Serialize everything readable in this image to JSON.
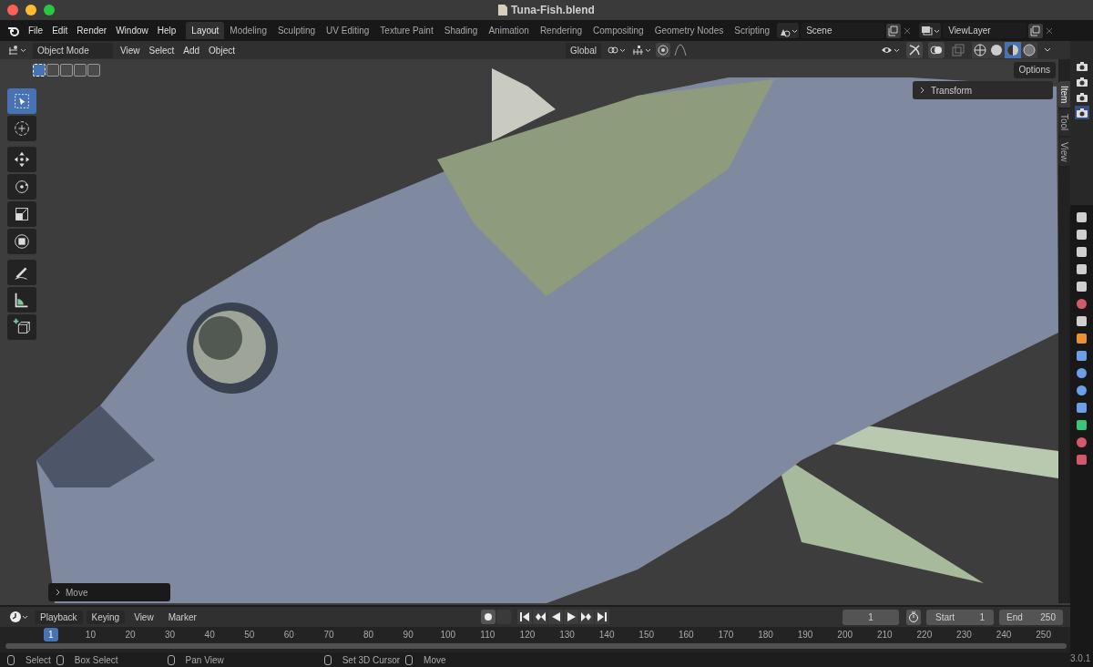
{
  "window": {
    "title": "Tuna-Fish.blend"
  },
  "menus": [
    "File",
    "Edit",
    "Render",
    "Window",
    "Help"
  ],
  "workspaces": [
    {
      "label": "Layout",
      "selected": true
    },
    {
      "label": "Modeling",
      "selected": false
    },
    {
      "label": "Sculpting",
      "selected": false
    },
    {
      "label": "UV Editing",
      "selected": false
    },
    {
      "label": "Texture Paint",
      "selected": false
    },
    {
      "label": "Shading",
      "selected": false
    },
    {
      "label": "Animation",
      "selected": false
    },
    {
      "label": "Rendering",
      "selected": false
    },
    {
      "label": "Compositing",
      "selected": false
    },
    {
      "label": "Geometry Nodes",
      "selected": false
    },
    {
      "label": "Scripting",
      "selected": false
    }
  ],
  "scene": "Scene",
  "view_layer": "ViewLayer",
  "viewport_header": {
    "mode": "Object Mode",
    "menus": [
      "View",
      "Select",
      "Add",
      "Object"
    ],
    "orientation": "Global",
    "select_modes": [
      {
        "selected": true
      },
      {
        "selected": false
      },
      {
        "selected": false
      },
      {
        "selected": false
      },
      {
        "selected": false
      }
    ],
    "shading": [
      {
        "kind": "wireframe",
        "selected": false
      },
      {
        "kind": "solid",
        "selected": false
      },
      {
        "kind": "material",
        "selected": true
      },
      {
        "kind": "rendered",
        "selected": false
      }
    ]
  },
  "tools": [
    {
      "kind": "select",
      "selected": true
    },
    {
      "kind": "cursor",
      "selected": false
    },
    {
      "kind": "move",
      "selected": false
    },
    {
      "kind": "rotate",
      "selected": false
    },
    {
      "kind": "scale",
      "selected": false
    },
    {
      "kind": "transform",
      "selected": false
    },
    {
      "kind": "annotate",
      "selected": false
    },
    {
      "kind": "measure",
      "selected": false
    },
    {
      "kind": "add-cube",
      "selected": false
    }
  ],
  "options": "Options",
  "transform_panel": "Transform",
  "sidebar_tabs": [
    {
      "label": "Item",
      "selected": true
    },
    {
      "label": "Tool",
      "selected": false
    },
    {
      "label": "View",
      "selected": false
    }
  ],
  "operator_panel": "Move",
  "outliner_rows": [
    {
      "selected": false
    },
    {
      "selected": false
    },
    {
      "selected": false
    },
    {
      "selected": true
    }
  ],
  "properties_tabs": [
    {
      "kind": "tool",
      "color": "#cfcfcf"
    },
    {
      "kind": "render",
      "color": "#cfcfcf"
    },
    {
      "kind": "output",
      "color": "#cfcfcf"
    },
    {
      "kind": "view-layer",
      "color": "#cfcfcf"
    },
    {
      "kind": "scene",
      "color": "#cfcfcf"
    },
    {
      "kind": "world",
      "color": "#d05a6a"
    },
    {
      "kind": "collection",
      "color": "#cfcfcf"
    },
    {
      "kind": "object",
      "color": "#e8913a"
    },
    {
      "kind": "modifier",
      "color": "#6d9ee8"
    },
    {
      "kind": "particles",
      "color": "#6d9ee8"
    },
    {
      "kind": "physics",
      "color": "#6d9ee8"
    },
    {
      "kind": "constraints",
      "color": "#6d9ee8"
    },
    {
      "kind": "data",
      "color": "#3ec47a"
    },
    {
      "kind": "material",
      "color": "#d05a6a"
    },
    {
      "kind": "texture",
      "color": "#d05a6a"
    }
  ],
  "timeline": {
    "menus": [
      "Playback",
      "Keying",
      "View",
      "Marker"
    ],
    "current_frame": "1",
    "start_label": "Start",
    "start": "1",
    "end_label": "End",
    "end": "250",
    "ruler": [
      {
        "label": "1",
        "selected": true
      },
      {
        "label": "10",
        "selected": false
      },
      {
        "label": "20",
        "selected": false
      },
      {
        "label": "30",
        "selected": false
      },
      {
        "label": "40",
        "selected": false
      },
      {
        "label": "50",
        "selected": false
      },
      {
        "label": "60",
        "selected": false
      },
      {
        "label": "70",
        "selected": false
      },
      {
        "label": "80",
        "selected": false
      },
      {
        "label": "90",
        "selected": false
      },
      {
        "label": "100",
        "selected": false
      },
      {
        "label": "110",
        "selected": false
      },
      {
        "label": "120",
        "selected": false
      },
      {
        "label": "130",
        "selected": false
      },
      {
        "label": "140",
        "selected": false
      },
      {
        "label": "150",
        "selected": false
      },
      {
        "label": "160",
        "selected": false
      },
      {
        "label": "170",
        "selected": false
      },
      {
        "label": "180",
        "selected": false
      },
      {
        "label": "190",
        "selected": false
      },
      {
        "label": "200",
        "selected": false
      },
      {
        "label": "210",
        "selected": false
      },
      {
        "label": "220",
        "selected": false
      },
      {
        "label": "230",
        "selected": false
      },
      {
        "label": "240",
        "selected": false
      },
      {
        "label": "250",
        "selected": false
      }
    ]
  },
  "status_bar": {
    "hints": [
      {
        "text": "Select"
      },
      {
        "text": "Box Select"
      },
      {
        "text": "Pan View"
      },
      {
        "text": "Set 3D Cursor"
      },
      {
        "text": "Move"
      }
    ],
    "version": "3.0.1"
  }
}
